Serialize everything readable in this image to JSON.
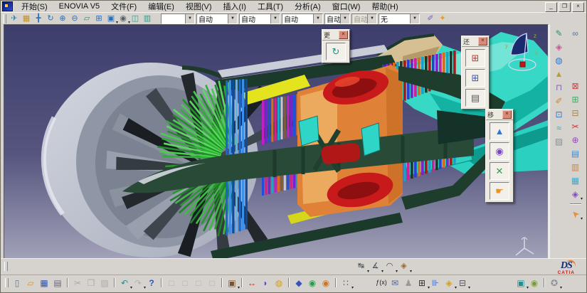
{
  "window": {
    "controls": {
      "minimize": "_",
      "restore": "❐",
      "close": "×"
    }
  },
  "menu_bar": {
    "items": [
      {
        "label": "开始(S)"
      },
      {
        "label": "ENOVIA V5"
      },
      {
        "label": "文件(F)"
      },
      {
        "label": "编辑(E)"
      },
      {
        "label": "视图(V)"
      },
      {
        "label": "插入(I)"
      },
      {
        "label": "工具(T)"
      },
      {
        "label": "分析(A)"
      },
      {
        "label": "窗口(W)"
      },
      {
        "label": "帮助(H)"
      }
    ]
  },
  "view_toolbar": {
    "left_icons": [
      {
        "n": "fly-mode",
        "g": "✈",
        "c": "#2f7fb0"
      },
      {
        "n": "fit-all-in",
        "g": "▦",
        "c": "#c89020"
      },
      {
        "n": "pan",
        "g": "╋",
        "c": "#2a6fbb"
      },
      {
        "n": "rotate",
        "g": "↻",
        "c": "#2a6fbb"
      },
      {
        "n": "zoom-in",
        "g": "⊕",
        "c": "#2a6fbb"
      },
      {
        "n": "zoom-out",
        "g": "⊖",
        "c": "#2a6fbb"
      },
      {
        "n": "normal-view",
        "g": "▱",
        "c": "#3a8f5f"
      },
      {
        "n": "multi-view",
        "g": "⊞",
        "c": "#2a6fbb"
      },
      {
        "n": "iso-view",
        "g": "▣",
        "c": "#2a6fbb",
        "dd": true
      },
      {
        "n": "shading-mode",
        "g": "◉",
        "c": "#556066",
        "dd": true
      },
      {
        "n": "hide-show",
        "g": "◫",
        "c": "#2a9d8f"
      },
      {
        "n": "swap-visible-space",
        "g": "▥",
        "c": "#2a9d8f"
      }
    ],
    "combos": [
      {
        "value": "",
        "disabled": false
      },
      {
        "value": "自动",
        "disabled": false
      },
      {
        "value": "自动",
        "disabled": false
      },
      {
        "value": "自动",
        "disabled": false
      },
      {
        "value": "自动",
        "disabled": false
      },
      {
        "value": "自动",
        "disabled": true
      },
      {
        "value": "无",
        "disabled": false
      }
    ],
    "right_icons": [
      {
        "n": "paintbrush-style",
        "g": "✐",
        "c": "#7a5acd"
      },
      {
        "n": "wizard",
        "g": "✦",
        "c": "#e0a020"
      }
    ]
  },
  "viewport": {
    "compass": {
      "x_label": "x",
      "y_label": "y",
      "z_label": "z"
    },
    "floating_toolbars": [
      {
        "title": "更",
        "close": "×",
        "buttons": [
          {
            "n": "update",
            "g": "↻",
            "c": "#1f8f8f"
          }
        ]
      },
      {
        "title": "还",
        "close": "×",
        "buttons": [
          {
            "n": "knowledge-launch",
            "g": "⊞",
            "c": "#cc3333"
          },
          {
            "n": "design-table",
            "g": "⊞",
            "c": "#3355cc"
          },
          {
            "n": "calculator",
            "g": "▤",
            "c": "#555a66"
          }
        ]
      },
      {
        "title": "移",
        "close": "×",
        "buttons": [
          {
            "n": "fly-move",
            "g": "▲",
            "c": "#3377cc"
          },
          {
            "n": "examine-move",
            "g": "◉",
            "c": "#7744cc"
          },
          {
            "n": "jack-move",
            "g": "✕",
            "c": "#2a9d4a"
          },
          {
            "n": "hand-drag",
            "g": "☛",
            "c": "#e8912d"
          }
        ]
      }
    ]
  },
  "right_toolbar": {
    "col_a": [
      {
        "n": "sketcher",
        "g": "✎",
        "c": "#2f8f6f"
      },
      {
        "n": "paint-material",
        "g": "◈",
        "c": "#cc5599"
      },
      {
        "n": "camera",
        "g": "◍",
        "c": "#3377cc"
      },
      {
        "n": "apply-material",
        "g": "▲",
        "c": "#b8a030"
      },
      {
        "n": "measure-weight",
        "g": "⊓",
        "c": "#8866aa"
      },
      {
        "n": "annotate-pen",
        "g": "✐",
        "c": "#cc8833"
      },
      {
        "n": "select-zone",
        "g": "⊡",
        "c": "#3377cc"
      },
      {
        "n": "spline-curve",
        "g": "≈",
        "c": "#2aa9a0"
      },
      {
        "n": "shade-box",
        "g": "▨",
        "c": "#888f99"
      }
    ],
    "col_b": [
      {
        "n": "link-manager",
        "g": "∞",
        "c": "#3377cc"
      },
      {
        "gap": 52
      },
      {
        "n": "scene-red",
        "g": "⊠",
        "c": "#cc4444"
      },
      {
        "n": "scene-green",
        "g": "⊞",
        "c": "#44aa66"
      },
      {
        "n": "scene-brown",
        "g": "⊟",
        "c": "#aa8844"
      },
      {
        "n": "section-cut",
        "g": "✂",
        "c": "#cc3333"
      },
      {
        "n": "clash-analysis",
        "g": "⊕",
        "c": "#9944cc"
      },
      {
        "n": "compare-a",
        "g": "▤",
        "c": "#4488cc"
      },
      {
        "n": "compare-b",
        "g": "▥",
        "c": "#cc8844"
      },
      {
        "n": "compare-c",
        "g": "▦",
        "c": "#44aacc"
      },
      {
        "n": "group-tools",
        "g": "◈",
        "c": "#8844cc",
        "dd": true
      },
      {
        "sep": true
      },
      {
        "n": "select-cursor",
        "g": "➤",
        "c": "#e8912d",
        "rot": -135,
        "fs": 13,
        "dd": true
      }
    ]
  },
  "bottom": {
    "measure_row": [
      {
        "n": "measure-between",
        "g": "↹",
        "c": "#444a55",
        "dd": true
      },
      {
        "n": "measure-item",
        "g": "∡",
        "c": "#444a55",
        "dd": true
      },
      {
        "n": "annotation-balloon",
        "g": "◠",
        "c": "#445",
        "dd": true
      },
      {
        "n": "measure-inertia",
        "g": "◈",
        "c": "#9a6a2a",
        "dd": true
      }
    ],
    "logo": {
      "ds": "DS",
      "name": "CATIA"
    },
    "standard_row": [
      {
        "n": "new-document",
        "g": "▯",
        "c": "#667788"
      },
      {
        "n": "open-folder",
        "g": "▱",
        "c": "#d79c22"
      },
      {
        "n": "save",
        "g": "▦",
        "c": "#3355aa"
      },
      {
        "n": "print",
        "g": "▤",
        "c": "#667"
      },
      {
        "sep": true
      },
      {
        "n": "cut",
        "g": "✂",
        "c": "#a2a2a2",
        "d": true
      },
      {
        "n": "copy",
        "g": "❐",
        "c": "#a2a2a2",
        "d": true
      },
      {
        "n": "paste",
        "g": "▨",
        "c": "#a2a2a2",
        "d": true
      },
      {
        "sep": true
      },
      {
        "n": "undo",
        "g": "↶",
        "c": "#1f8f8f",
        "dd": true
      },
      {
        "n": "redo",
        "g": "↷",
        "c": "#a8a8a8",
        "d": true,
        "dd": true
      },
      {
        "n": "whats-this-help",
        "g": "?",
        "c": "#2255cc",
        "bold": true
      },
      {
        "sep": true
      },
      {
        "n": "arrange-1",
        "g": "□",
        "c": "#a8a8a8",
        "d": true
      },
      {
        "n": "arrange-2",
        "g": "□",
        "c": "#a8a8a8",
        "d": true
      },
      {
        "n": "arrange-3",
        "g": "□",
        "c": "#a8a8a8",
        "d": true
      },
      {
        "n": "arrange-4",
        "g": "□",
        "c": "#a8a8a8",
        "d": true
      },
      {
        "sep": true
      },
      {
        "n": "catalog-browser",
        "g": "▣",
        "c": "#7a5230",
        "dd": true
      },
      {
        "sep": true
      },
      {
        "n": "two-way-resize",
        "g": "↔",
        "c": "#cc2222"
      },
      {
        "n": "knowledge-volume",
        "g": "◗",
        "c": "#7744cc"
      },
      {
        "n": "lock-padlock",
        "g": "◍",
        "c": "#d4a017"
      },
      {
        "sep": true
      },
      {
        "n": "catalog-book",
        "g": "◆",
        "c": "#3355bb"
      },
      {
        "n": "part-green",
        "g": "◉",
        "c": "#2a9d4a"
      },
      {
        "n": "part-orange",
        "g": "◉",
        "c": "#cc7722"
      },
      {
        "sep": true
      },
      {
        "n": "fast-instantiation",
        "g": "∷",
        "c": "#556",
        "dd": true
      },
      {
        "gap": 30
      },
      {
        "n": "formula-fx",
        "g": "ƒ(x)",
        "c": "#222",
        "fs": 9
      },
      {
        "n": "comment-message",
        "g": "✉",
        "c": "#556699"
      },
      {
        "n": "manikin",
        "g": "♟",
        "c": "#999"
      },
      {
        "n": "design-table",
        "g": "⊞",
        "c": "#333",
        "dd": true
      },
      {
        "n": "relations-chart",
        "g": "⊪",
        "c": "#3366cc"
      },
      {
        "n": "knowledge-lock",
        "g": "◈",
        "c": "#d4a017",
        "dd": true
      },
      {
        "n": "tree-filter",
        "g": "⊟",
        "c": "#556",
        "dd": true
      },
      {
        "gap": 62
      },
      {
        "n": "dmu-box",
        "g": "▣",
        "c": "#1f8f8f",
        "dd": true
      },
      {
        "n": "dmu-sphere",
        "g": "◉",
        "c": "#7a9e3a"
      },
      {
        "sep": true
      },
      {
        "n": "vr-wheel",
        "g": "✪",
        "c": "#888f99",
        "dd": true
      }
    ]
  }
}
